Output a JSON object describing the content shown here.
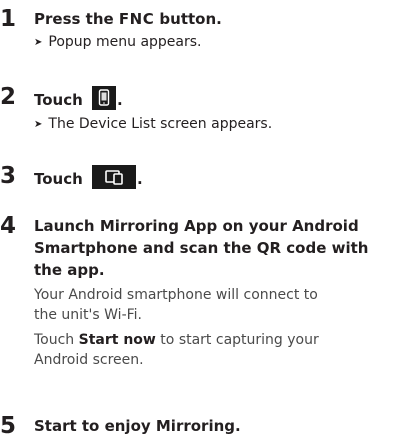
{
  "steps": [
    {
      "number": "1",
      "title_pre": "Press the ",
      "title_key": "FNC",
      "title_post": " button.",
      "result": "Popup menu appears."
    },
    {
      "number": "2",
      "title_pre": "Touch ",
      "title_post": ".",
      "icon": "device-list-icon",
      "result": "The Device List screen appears."
    },
    {
      "number": "3",
      "title_pre": "Touch ",
      "title_post": ".",
      "icon": "mirroring-icon"
    },
    {
      "number": "4",
      "title_line1": "Launch Mirroring App on your Android",
      "title_line2": "Smartphone and scan the QR code with",
      "title_line3": "the app.",
      "body1_line1": "Your Android smartphone will connect to",
      "body1_line2": "the unit's Wi-Fi.",
      "body2_pre": "Touch ",
      "body2_bold": "Start now",
      "body2_post_line1": " to start capturing your",
      "body2_line2": "Android screen."
    },
    {
      "number": "5",
      "title": "Start to enjoy Mirroring."
    }
  ],
  "arrow_symbol": "➤",
  "colors": {
    "text": "#231f20",
    "body_text": "#4a4a4a",
    "icon_bg": "#1a1a1a"
  }
}
